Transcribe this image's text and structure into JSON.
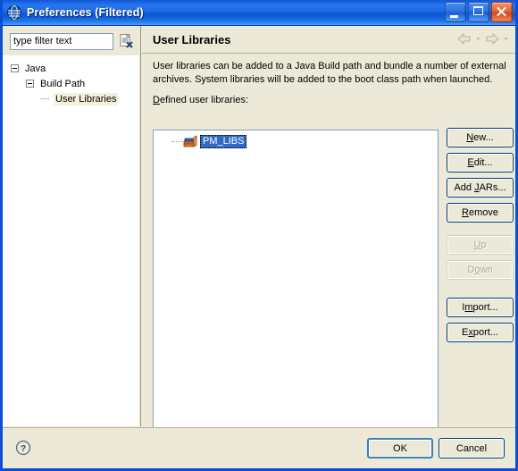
{
  "window": {
    "title": "Preferences (Filtered)",
    "icon": "eclipse-globe-icon",
    "controls": {
      "minimize": "minimize-button",
      "maximize": "maximize-button",
      "close": "close-button"
    }
  },
  "filter": {
    "value": "type filter text",
    "placeholder": "type filter text",
    "clear_icon": "clear-filter-icon"
  },
  "tree": {
    "items": [
      {
        "label": "Java",
        "level": 0,
        "expanded": true,
        "selected": false
      },
      {
        "label": "Build Path",
        "level": 1,
        "expanded": true,
        "selected": false
      },
      {
        "label": "User Libraries",
        "level": 2,
        "expanded": false,
        "selected": true
      }
    ]
  },
  "pane": {
    "title": "User Libraries",
    "description": "User libraries can be added to a Java Build path and bundle a number of external archives. System libraries will be added to the boot class path when launched.",
    "defined_label": "Defined user libraries:",
    "nav": {
      "back": "back-arrow-icon",
      "back_menu": "back-dropdown-icon",
      "forward": "forward-arrow-icon",
      "forward_menu": "forward-dropdown-icon"
    }
  },
  "library_list": {
    "items": [
      {
        "name": "PM_LIBS",
        "icon": "library-books-icon",
        "selected": true
      }
    ]
  },
  "buttons": {
    "side": [
      {
        "label": "New...",
        "mnemonic": "N",
        "disabled": false,
        "name": "new-button"
      },
      {
        "label": "Edit...",
        "mnemonic": "E",
        "disabled": false,
        "name": "edit-button"
      },
      {
        "label": "Add JARs...",
        "mnemonic": "J",
        "disabled": false,
        "name": "add-jars-button"
      },
      {
        "label": "Remove",
        "mnemonic": "R",
        "disabled": false,
        "name": "remove-button"
      },
      {
        "label": "Up",
        "mnemonic": "U",
        "disabled": true,
        "name": "up-button"
      },
      {
        "label": "Down",
        "mnemonic": "o",
        "disabled": true,
        "name": "down-button"
      },
      {
        "label": "Import...",
        "mnemonic": "m",
        "disabled": false,
        "name": "import-button"
      },
      {
        "label": "Export...",
        "mnemonic": "x",
        "disabled": false,
        "name": "export-button"
      }
    ]
  },
  "footer": {
    "help_icon": "help-question-icon",
    "ok_label": "OK",
    "cancel_label": "Cancel"
  },
  "colors": {
    "title_bar": "#1a64e2",
    "dialog_bg": "#ece9d8",
    "selection": "#316ac5",
    "tree_selection": "#f5f0dc",
    "border": "#0a4fd6"
  }
}
